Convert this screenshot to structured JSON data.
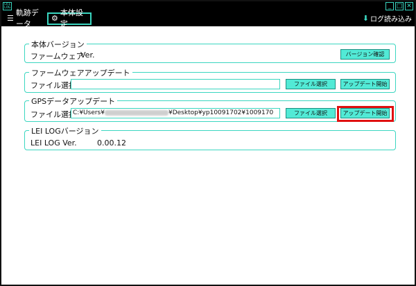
{
  "window": {
    "logo": "LEI LOG"
  },
  "tabs": [
    {
      "label": "軌跡データ",
      "icon": "list-icon"
    },
    {
      "label": "本体設定",
      "icon": "gear-icon"
    }
  ],
  "download": {
    "label": "ログ読み込み",
    "icon": "download-arrow-icon"
  },
  "sections": {
    "version": {
      "title": "本体バージョン",
      "firmware_label": "ファームウェア",
      "ver_label": "Ver.",
      "button": "バージョン確認"
    },
    "firmware_update": {
      "title": "ファームウェアアップデート",
      "file_label": "ファイル選択",
      "file_value": "",
      "select_button": "ファイル選択",
      "start_button": "アップデート開始"
    },
    "gps_update": {
      "title": "GPSデータアップデート",
      "file_label": "ファイル選択",
      "path_prefix": "C:¥Users¥",
      "path_suffix": "¥Desktop¥yp10091702¥1009170",
      "select_button": "ファイル選択",
      "start_button": "アップデート開始"
    },
    "leilog": {
      "title": "LEI LOGバージョン",
      "ver_label": "LEI LOG Ver.",
      "ver_value": "0.00.12"
    }
  },
  "colors": {
    "accent": "#3ad6c0",
    "button": "#52ead6",
    "highlight": "#e01010"
  }
}
